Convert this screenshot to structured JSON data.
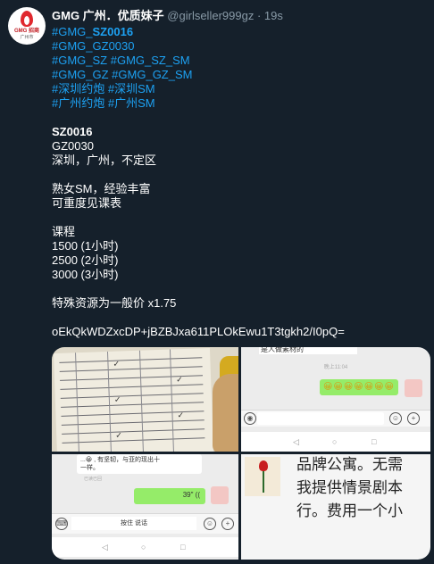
{
  "tweet": {
    "author_name": "GMG 广州．优质妹子",
    "handle": "@girlseller999gz",
    "separator": "·",
    "time": "19s",
    "avatar_text": "GMG 招商",
    "avatar_sub": "广州市",
    "hashtags": {
      "line1_prefix": "#GMG_",
      "line1_bold": "SZ0016",
      "line2": "#GMG_GZ0030",
      "line3": "#GMG_SZ #GMG_SZ_SM",
      "line4": "#GMG_GZ #GMG_GZ_SM",
      "line5": "#深圳约炮 #深圳SM",
      "line6": "#广州约炮 #广州SM"
    },
    "body": {
      "code1": "SZ0016",
      "code2": "GZ0030",
      "location": "深圳，广州，不定区",
      "desc1": "熟女SM，经验丰富",
      "desc2": "可重度见课表",
      "course_title": "课程",
      "price1": "1500 (1小时)",
      "price2": "2500 (2小时)",
      "price3": "3000 (3小时)",
      "special": "特殊资源为一般价 x1.75",
      "cipher": "oEkQkWDZxcDP+jBZBJxa611PLOkEwu1T3tgkh2/I0pQ="
    }
  },
  "media": {
    "tile2": {
      "top_text": "是人做素材的",
      "timestamp": "晚上11:04",
      "emoji": "😀😀😀😀😀😀😀"
    },
    "tile3": {
      "bubble_text_1": "...😀 , 有坚韧，与亚的现出十",
      "bubble_text_2": "一样。",
      "meta": "已读已回",
      "voice": "39\" ((",
      "hold_to_talk": "按住 说话"
    },
    "tile4": {
      "line1": "品牌公寓。无需",
      "line2": "我提供情景剧本",
      "line3": "行。费用一个小"
    }
  }
}
